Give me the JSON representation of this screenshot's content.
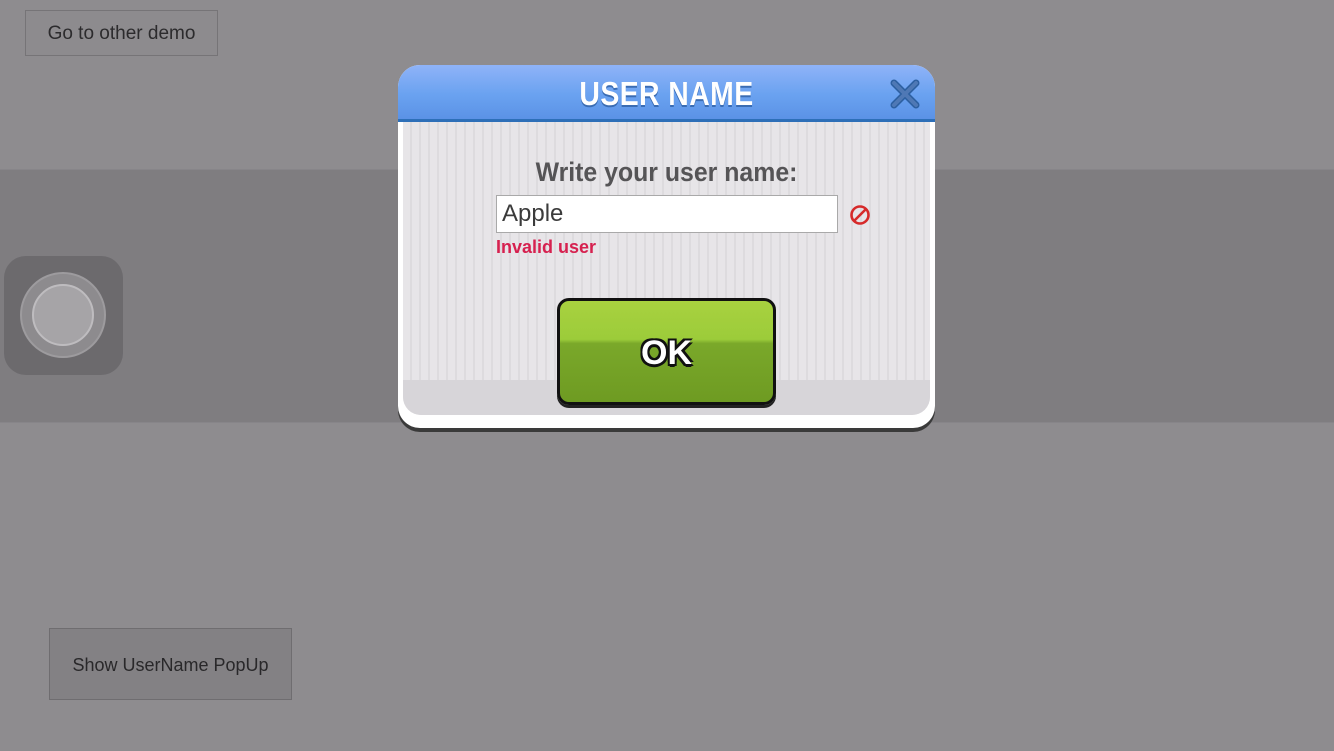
{
  "scene": {
    "top_button_label": "Go to other demo",
    "bottom_button_label": "Show UserName PopUp"
  },
  "popup": {
    "title": "USER NAME",
    "prompt": "Write your user name:",
    "input_value": "Apple",
    "error_message": "Invalid user",
    "ok_label": "OK",
    "close_icon": "close-icon",
    "error_icon": "prohibited-icon"
  },
  "colors": {
    "header_blue": "#6aa2f0",
    "ok_green": "#8cbf32",
    "error_red": "#d6214f",
    "overlay_gray": "#8e8c8f"
  }
}
